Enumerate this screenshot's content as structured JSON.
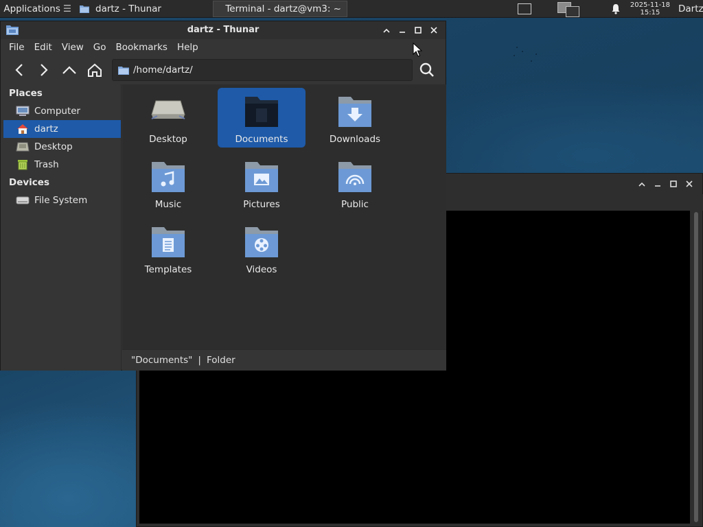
{
  "panel": {
    "applications_label": "Applications",
    "tasks": [
      {
        "label": "dartz - Thunar"
      },
      {
        "label": "Terminal - dartz@vm3: ~"
      }
    ],
    "clock_date": "2025-11-18",
    "clock_time": "15:15",
    "user": "Dartz"
  },
  "thunar": {
    "title": "dartz - Thunar",
    "menu": [
      "File",
      "Edit",
      "View",
      "Go",
      "Bookmarks",
      "Help"
    ],
    "path": "/home/dartz/",
    "sidebar": {
      "places_header": "Places",
      "places": [
        {
          "label": "Computer",
          "icon": "computer-icon"
        },
        {
          "label": "dartz",
          "icon": "home-icon",
          "active": true
        },
        {
          "label": "Desktop",
          "icon": "desktop-icon"
        },
        {
          "label": "Trash",
          "icon": "trash-icon"
        }
      ],
      "devices_header": "Devices",
      "devices": [
        {
          "label": "File System",
          "icon": "drive-icon"
        }
      ]
    },
    "files": [
      {
        "label": "Desktop",
        "icon": "desktop-folder-icon"
      },
      {
        "label": "Documents",
        "icon": "documents-folder-icon",
        "selected": true
      },
      {
        "label": "Downloads",
        "icon": "downloads-folder-icon"
      },
      {
        "label": "Music",
        "icon": "music-folder-icon"
      },
      {
        "label": "Pictures",
        "icon": "pictures-folder-icon"
      },
      {
        "label": "Public",
        "icon": "public-folder-icon"
      },
      {
        "label": "Templates",
        "icon": "templates-folder-icon"
      },
      {
        "label": "Videos",
        "icon": "videos-folder-icon"
      }
    ],
    "status": {
      "name": "\"Documents\"",
      "separator": "|",
      "type": "Folder"
    }
  },
  "colors": {
    "selection": "#1e5aa8",
    "folder_blue": "#5b8fd0",
    "window_bg": "#353535",
    "content_bg": "#2d2d2d"
  }
}
